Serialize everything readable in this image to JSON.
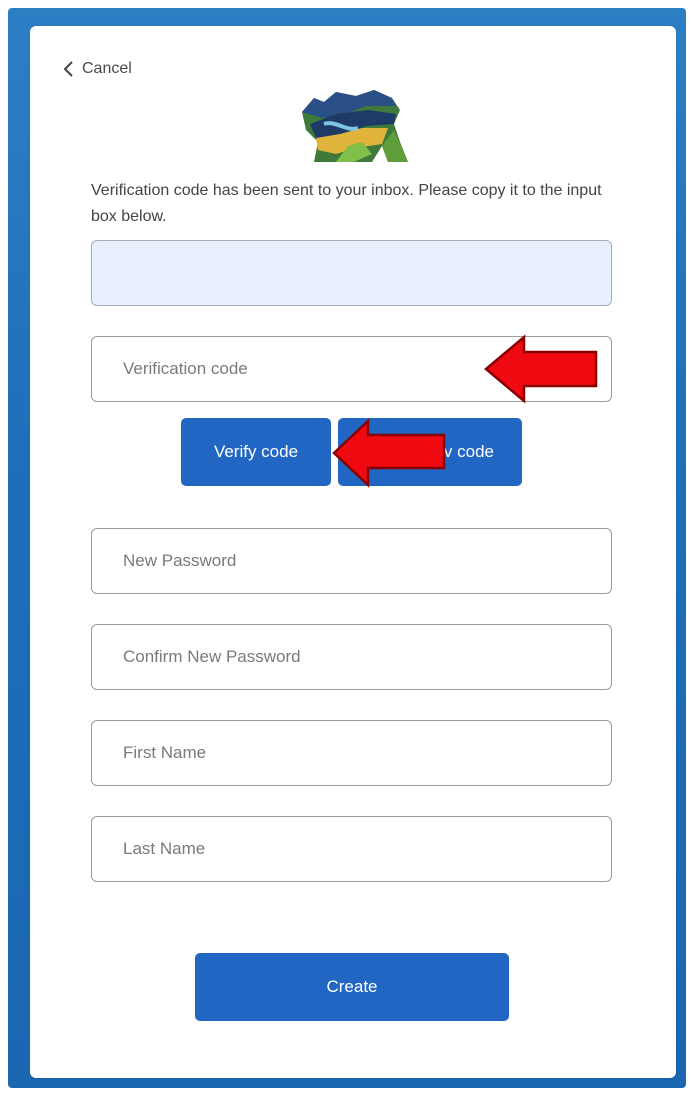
{
  "header": {
    "cancel_label": "Cancel"
  },
  "message": "Verification code has been sent to your inbox. Please copy it to the input box below.",
  "email_value": "",
  "fields": {
    "verification_code_placeholder": "Verification code",
    "new_password_placeholder": "New Password",
    "confirm_password_placeholder": "Confirm New Password",
    "first_name_placeholder": "First Name",
    "last_name_placeholder": "Last Name"
  },
  "buttons": {
    "verify_label": "Verify code",
    "send_new_partial_label": "v code",
    "create_label": "Create"
  },
  "colors": {
    "primary": "#2266c4",
    "frame": "#1f6fba",
    "annotation_arrow": "#e8000b"
  }
}
